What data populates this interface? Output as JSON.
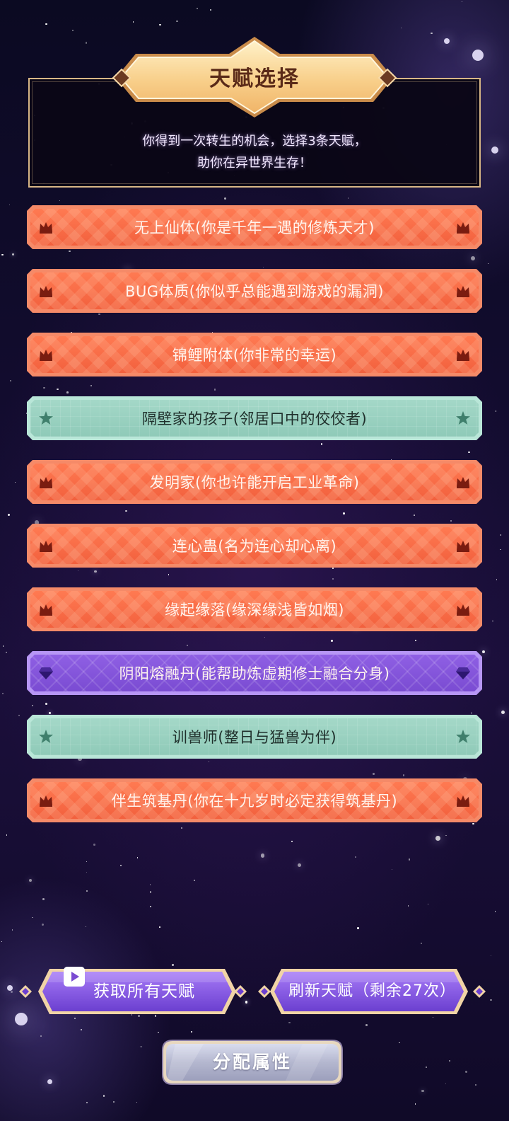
{
  "header": {
    "title": "天赋选择",
    "description_line1": "你得到一次转生的机会，选择3条天赋，",
    "description_line2": "助你在异世界生存！"
  },
  "talents": [
    {
      "label": "无上仙体(你是千年一遇的修炼天才)",
      "rarity": "orange",
      "icon": "crown-icon"
    },
    {
      "label": "BUG体质(你似乎总能遇到游戏的漏洞)",
      "rarity": "orange",
      "icon": "crown-icon"
    },
    {
      "label": "锦鲤附体(你非常的幸运)",
      "rarity": "orange",
      "icon": "crown-icon"
    },
    {
      "label": "隔壁家的孩子(邻居口中的佼佼者)",
      "rarity": "green",
      "icon": "star-icon"
    },
    {
      "label": "发明家(你也许能开启工业革命)",
      "rarity": "orange",
      "icon": "crown-icon"
    },
    {
      "label": "连心蛊(名为连心却心离)",
      "rarity": "orange",
      "icon": "crown-icon"
    },
    {
      "label": "缘起缘落(缘深缘浅皆如烟)",
      "rarity": "orange",
      "icon": "crown-icon"
    },
    {
      "label": "阴阳熔融丹(能帮助炼虚期修士融合分身)",
      "rarity": "purple",
      "icon": "gem-icon"
    },
    {
      "label": "训兽师(整日与猛兽为伴)",
      "rarity": "green",
      "icon": "star-icon"
    },
    {
      "label": "伴生筑基丹(你在十九岁时必定获得筑基丹)",
      "rarity": "orange",
      "icon": "crown-icon"
    }
  ],
  "buttons": {
    "get_all": "获取所有天赋",
    "refresh": "刷新天赋（剩余27次）",
    "assign": "分配属性"
  },
  "colors": {
    "orange": "#f2603d",
    "green": "#9ad2c1",
    "purple": "#8456da",
    "gold_border": "#d8b786"
  }
}
